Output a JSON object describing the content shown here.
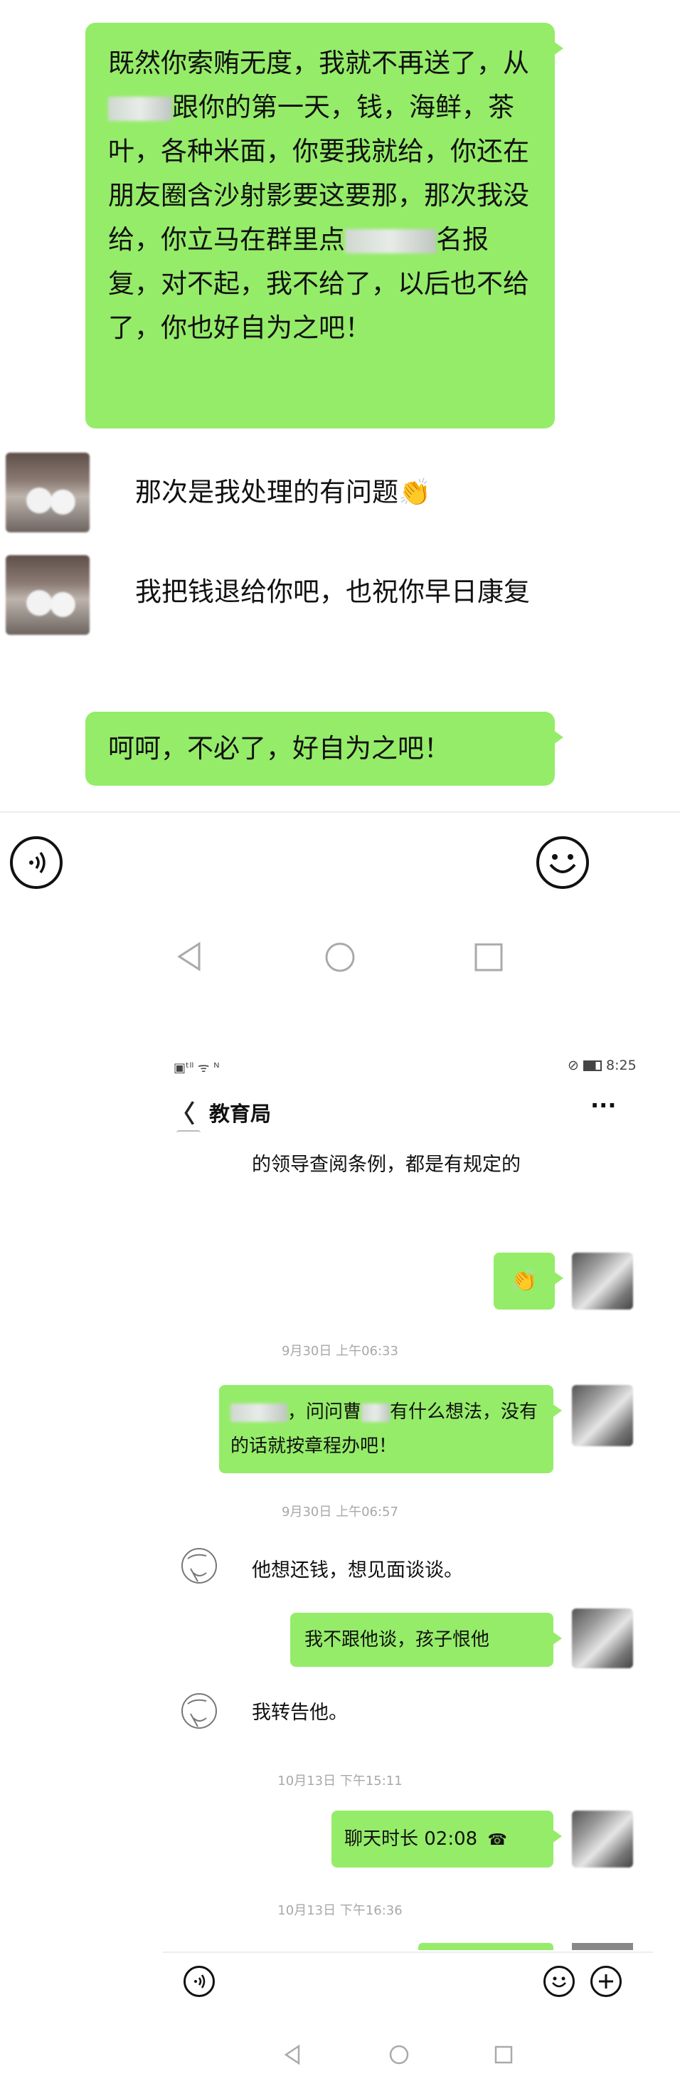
{
  "chat1": {
    "messages": [
      {
        "side": "right",
        "text_parts": [
          "既然你索贿无度，我就不再送了，从",
          "跟你的第一天，钱，海鲜，茶叶，各种米面，你要我就给，你还在朋友圈含沙射影要这要那，那次我没给，你立马在群里点",
          "名报复，对不起，我不给了，以后也不给了，你也好自为之吧！"
        ]
      },
      {
        "side": "left",
        "text": "那次是我处理的有问题",
        "emoji": "👏"
      },
      {
        "side": "left",
        "text": "我把钱退给你吧，也祝你早日康复"
      },
      {
        "side": "right",
        "text": "呵呵，不必了，好自为之吧！"
      }
    ],
    "input_bar": {
      "voice_icon": "voice-icon",
      "emoji_icon": "emoji-icon"
    },
    "nav": {
      "back": "back-triangle-icon",
      "home": "home-circle-icon",
      "recent": "recent-square-icon"
    }
  },
  "chat2": {
    "status_bar": {
      "left": "▣ᵗˡˡ ᯤ ᴺ",
      "time": "8:25"
    },
    "header": {
      "back_label": "〈",
      "title": "教育局",
      "more": "···"
    },
    "messages": [
      {
        "side": "left",
        "text": "的领导查阅条例，都是有规定的"
      },
      {
        "side": "right",
        "text": "👏"
      },
      {
        "type": "time",
        "text": "9月30日 上午06:33"
      },
      {
        "side": "right",
        "text_parts": [
          "，问问曹",
          "有什么想法，没有的话就按章程办吧！"
        ]
      },
      {
        "type": "time",
        "text": "9月30日 上午06:57"
      },
      {
        "side": "left",
        "text": "他想还钱，想见面谈谈。"
      },
      {
        "side": "right",
        "text": "我不跟他谈，孩子恨他"
      },
      {
        "side": "left",
        "text": "我转告他。"
      },
      {
        "type": "time",
        "text": "10月13日 下午15:11"
      },
      {
        "side": "right",
        "text": "聊天时长 02:08"
      },
      {
        "type": "time",
        "text": "10月13日 下午16:36"
      }
    ]
  }
}
